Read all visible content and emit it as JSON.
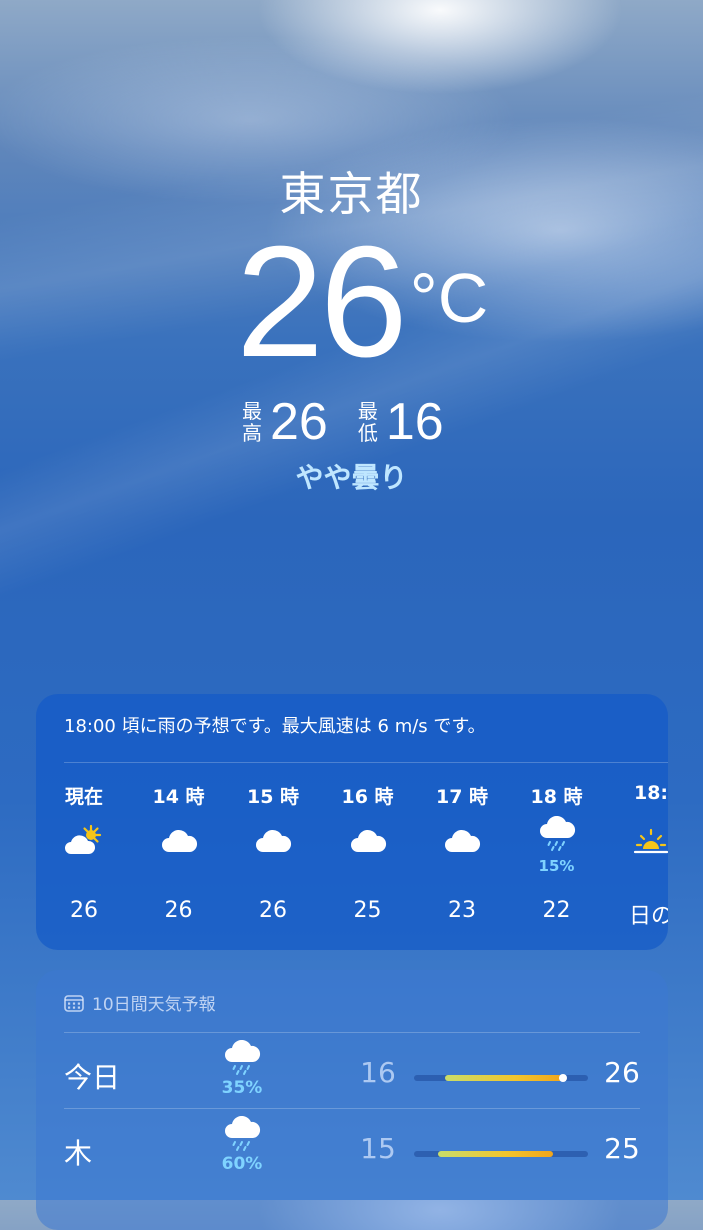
{
  "location": {
    "city": "東京都",
    "temperature": "26",
    "unit": "°C",
    "high_label": "最高",
    "high": "26",
    "low_label": "最低",
    "low": "16",
    "condition": "やや曇り"
  },
  "hourly": {
    "summary": "18:00 頃に雨の予想です。最大風速は 6 m/s です。",
    "items": [
      {
        "label": "現在",
        "icon": "partly-sunny-icon",
        "precip": "",
        "temp": "26"
      },
      {
        "label": "14 時",
        "icon": "cloud-icon",
        "precip": "",
        "temp": "26"
      },
      {
        "label": "15 時",
        "icon": "cloud-icon",
        "precip": "",
        "temp": "26"
      },
      {
        "label": "16 時",
        "icon": "cloud-icon",
        "precip": "",
        "temp": "25"
      },
      {
        "label": "17 時",
        "icon": "cloud-icon",
        "precip": "",
        "temp": "23"
      },
      {
        "label": "18 時",
        "icon": "cloud-rain-icon",
        "precip": "15%",
        "temp": "22"
      },
      {
        "label": "18:",
        "icon": "sunset-icon",
        "precip": "",
        "temp": "日の"
      }
    ]
  },
  "daily": {
    "header": "10日間天気予報",
    "header_icon": "calendar-icon",
    "days": [
      {
        "name": "今日",
        "icon": "cloud-rain-icon",
        "precip": "35%",
        "low": "16",
        "high": "26",
        "range_start": 0.18,
        "range_end": 0.86,
        "show_current": true,
        "current": 0.86
      },
      {
        "name": "木",
        "icon": "cloud-rain-icon",
        "precip": "60%",
        "low": "15",
        "high": "25",
        "range_start": 0.14,
        "range_end": 0.8,
        "show_current": false,
        "current": 0
      }
    ]
  },
  "colors": {
    "precip": "#7fd3ff",
    "condition": "#bfe6ff",
    "sun": "#f5c518"
  }
}
